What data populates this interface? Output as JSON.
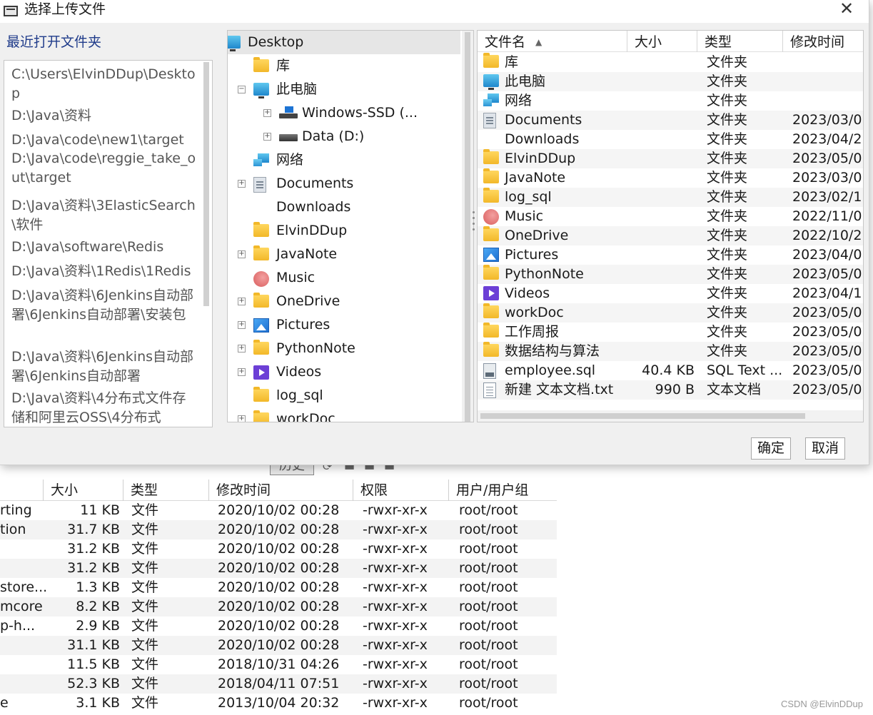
{
  "dialog": {
    "title": "选择上传文件",
    "recent_label": "最近打开文件夹",
    "recent_items": [
      "C:\\Users\\ElvinDDup\\Desktop",
      "D:\\Java\\资料",
      "D:\\Java\\code\\new1\\target",
      "D:\\Java\\code\\reggie_take_out\\target",
      "D:\\Java\\资料\\3ElasticSearch\\软件",
      "D:\\Java\\software\\Redis",
      "D:\\Java\\资料\\1Redis\\1Redis",
      "D:\\Java\\资料\\6Jenkins自动部署\\6Jenkins自动部署\\安装包",
      "D:\\Java\\资料\\6Jenkins自动部署\\6Jenkins自动部署",
      "D:\\Java\\资料\\4分布式文件存储和阿里云OSS\\4分布式"
    ],
    "tree": [
      {
        "label": "Desktop",
        "icon": "monitor"
      },
      {
        "label": "库",
        "icon": "folder"
      },
      {
        "label": "此电脑",
        "icon": "monitor"
      },
      {
        "label": "Windows-SSD (...",
        "icon": "drive-win"
      },
      {
        "label": "Data (D:)",
        "icon": "drive"
      },
      {
        "label": "网络",
        "icon": "network"
      },
      {
        "label": "Documents",
        "icon": "doc"
      },
      {
        "label": "Downloads",
        "icon": "download"
      },
      {
        "label": "ElvinDDup",
        "icon": "folder"
      },
      {
        "label": "JavaNote",
        "icon": "folder"
      },
      {
        "label": "Music",
        "icon": "music"
      },
      {
        "label": "OneDrive",
        "icon": "folder"
      },
      {
        "label": "Pictures",
        "icon": "picture"
      },
      {
        "label": "PythonNote",
        "icon": "folder"
      },
      {
        "label": "Videos",
        "icon": "video"
      },
      {
        "label": "log_sql",
        "icon": "folder"
      },
      {
        "label": "workDoc",
        "icon": "folder"
      }
    ],
    "files_header": {
      "name": "文件名",
      "size": "大小",
      "type": "类型",
      "date": "修改时间",
      "sort_icon": "▲"
    },
    "files": [
      {
        "name": "库",
        "size": "",
        "type": "文件夹",
        "date": "",
        "icon": "folder"
      },
      {
        "name": "此电脑",
        "size": "",
        "type": "文件夹",
        "date": "",
        "icon": "monitor"
      },
      {
        "name": "网络",
        "size": "",
        "type": "文件夹",
        "date": "",
        "icon": "network"
      },
      {
        "name": "Documents",
        "size": "",
        "type": "文件夹",
        "date": "2023/03/0",
        "icon": "doc"
      },
      {
        "name": "Downloads",
        "size": "",
        "type": "文件夹",
        "date": "2023/04/2",
        "icon": "download"
      },
      {
        "name": "ElvinDDup",
        "size": "",
        "type": "文件夹",
        "date": "2023/05/0",
        "icon": "folder"
      },
      {
        "name": "JavaNote",
        "size": "",
        "type": "文件夹",
        "date": "2023/03/0",
        "icon": "folder"
      },
      {
        "name": "log_sql",
        "size": "",
        "type": "文件夹",
        "date": "2023/02/1",
        "icon": "folder"
      },
      {
        "name": "Music",
        "size": "",
        "type": "文件夹",
        "date": "2022/11/0",
        "icon": "music"
      },
      {
        "name": "OneDrive",
        "size": "",
        "type": "文件夹",
        "date": "2022/10/2",
        "icon": "folder"
      },
      {
        "name": "Pictures",
        "size": "",
        "type": "文件夹",
        "date": "2023/04/0",
        "icon": "picture"
      },
      {
        "name": "PythonNote",
        "size": "",
        "type": "文件夹",
        "date": "2023/05/0",
        "icon": "folder"
      },
      {
        "name": "Videos",
        "size": "",
        "type": "文件夹",
        "date": "2023/04/1",
        "icon": "video"
      },
      {
        "name": "workDoc",
        "size": "",
        "type": "文件夹",
        "date": "2023/05/0",
        "icon": "folder"
      },
      {
        "name": "工作周报",
        "size": "",
        "type": "文件夹",
        "date": "2023/05/0",
        "icon": "folder"
      },
      {
        "name": "数据结构与算法",
        "size": "",
        "type": "文件夹",
        "date": "2023/05/0",
        "icon": "folder"
      },
      {
        "name": "employee.sql",
        "size": "40.4 KB",
        "type": "SQL Text ...",
        "date": "2023/05/0",
        "icon": "sqlfile"
      },
      {
        "name": "新建 文本文档.txt",
        "size": "990 B",
        "type": "文本文档",
        "date": "2023/05/0",
        "icon": "txtfile"
      }
    ],
    "ok_label": "确定",
    "cancel_label": "取消"
  },
  "background": {
    "history_label": "历史",
    "header": {
      "size": "大小",
      "type": "类型",
      "date": "修改时间",
      "perm": "权限",
      "owner": "用户/用户组"
    },
    "rows": [
      {
        "name": "rting",
        "size": "11 KB",
        "type": "文件",
        "date": "2020/10/02 00:28",
        "perm": "-rwxr-xr-x",
        "owner": "root/root"
      },
      {
        "name": "tion",
        "size": "31.7 KB",
        "type": "文件",
        "date": "2020/10/02 00:28",
        "perm": "-rwxr-xr-x",
        "owner": "root/root"
      },
      {
        "name": "",
        "size": "31.2 KB",
        "type": "文件",
        "date": "2020/10/02 00:28",
        "perm": "-rwxr-xr-x",
        "owner": "root/root"
      },
      {
        "name": "",
        "size": "31.2 KB",
        "type": "文件",
        "date": "2020/10/02 00:28",
        "perm": "-rwxr-xr-x",
        "owner": "root/root"
      },
      {
        "name": "store...",
        "size": "1.3 KB",
        "type": "文件",
        "date": "2020/10/02 00:28",
        "perm": "-rwxr-xr-x",
        "owner": "root/root"
      },
      {
        "name": "mcore",
        "size": "8.2 KB",
        "type": "文件",
        "date": "2020/10/02 00:28",
        "perm": "-rwxr-xr-x",
        "owner": "root/root"
      },
      {
        "name": "p-h...",
        "size": "2.9 KB",
        "type": "文件",
        "date": "2020/10/02 00:28",
        "perm": "-rwxr-xr-x",
        "owner": "root/root"
      },
      {
        "name": "",
        "size": "31.1 KB",
        "type": "文件",
        "date": "2020/10/02 00:28",
        "perm": "-rwxr-xr-x",
        "owner": "root/root"
      },
      {
        "name": "",
        "size": "11.5 KB",
        "type": "文件",
        "date": "2018/10/31 04:26",
        "perm": "-rwxr-xr-x",
        "owner": "root/root"
      },
      {
        "name": "",
        "size": "52.3 KB",
        "type": "文件",
        "date": "2018/04/11 07:51",
        "perm": "-rwxr-xr-x",
        "owner": "root/root"
      },
      {
        "name": "e",
        "size": "3.1 KB",
        "type": "文件",
        "date": "2013/10/04 20:32",
        "perm": "-rwxr-xr-x",
        "owner": "root/root"
      }
    ]
  },
  "watermark": "CSDN @ElvinDDup",
  "colors": {
    "recent_label": "#1f3b8a",
    "folder": "#f2b829",
    "selection": "#e6e6e6"
  }
}
